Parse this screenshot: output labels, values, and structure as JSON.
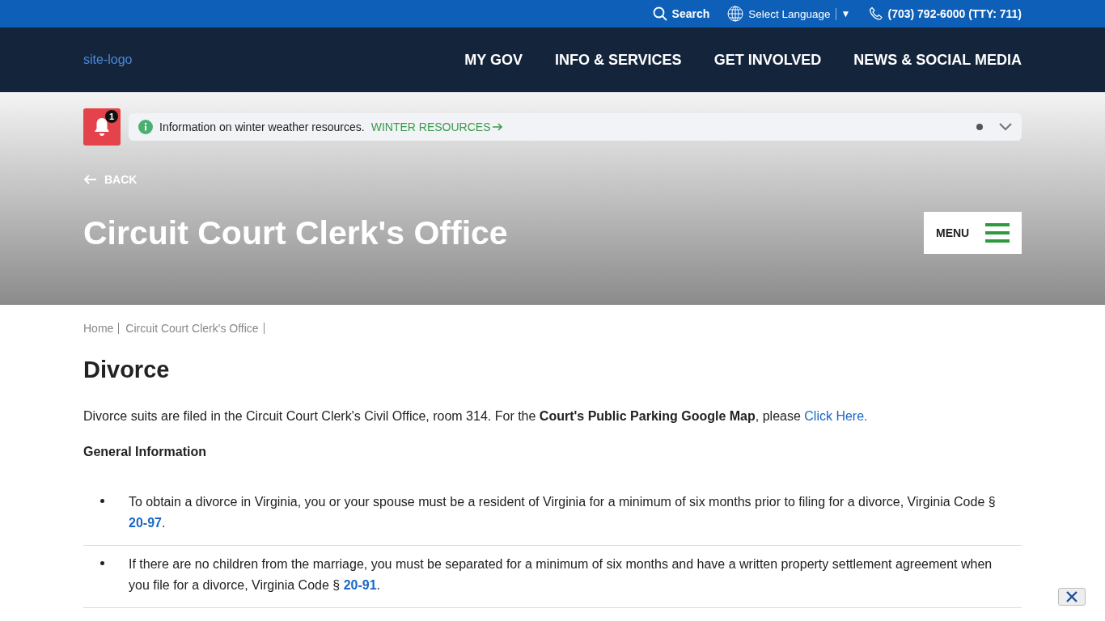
{
  "top_bar": {
    "search": "Search",
    "language": "Select Language",
    "language_caret": "▼",
    "phone": "(703) 792-6000 (TTY: 711)"
  },
  "header": {
    "logo_alt": "site-logo",
    "nav": [
      "MY GOV",
      "INFO & SERVICES",
      "GET INVOLVED",
      "NEWS & SOCIAL MEDIA"
    ]
  },
  "alert": {
    "count": "1",
    "message": "Information on winter weather resources.",
    "link": "WINTER RESOURCES"
  },
  "back": "BACK",
  "page_title": "Circuit Court Clerk's Office",
  "menu_button": "MENU",
  "breadcrumb": [
    "Home",
    "Circuit Court Clerk's Office"
  ],
  "heading": "Divorce",
  "intro": {
    "text": "Divorce suits are filed in the Circuit Court Clerk's Civil Office, room 314. For the **Court's Public Parking Google Map**, please ",
    "link": "Click Here."
  },
  "subheading": "General Information",
  "items": [
    {
      "text": "To obtain a divorce in Virginia, you or your spouse must be a resident of Virginia for a minimum of six months prior to filing for a divorce, Virginia Code § ",
      "link": "20-97",
      "after": "."
    },
    {
      "text": "If there are no children from the marriage, you must be separated for a minimum of six months and have a written property settlement agreement when you file for a divorce, Virginia Code § ",
      "link": "20-91",
      "after": "."
    }
  ]
}
